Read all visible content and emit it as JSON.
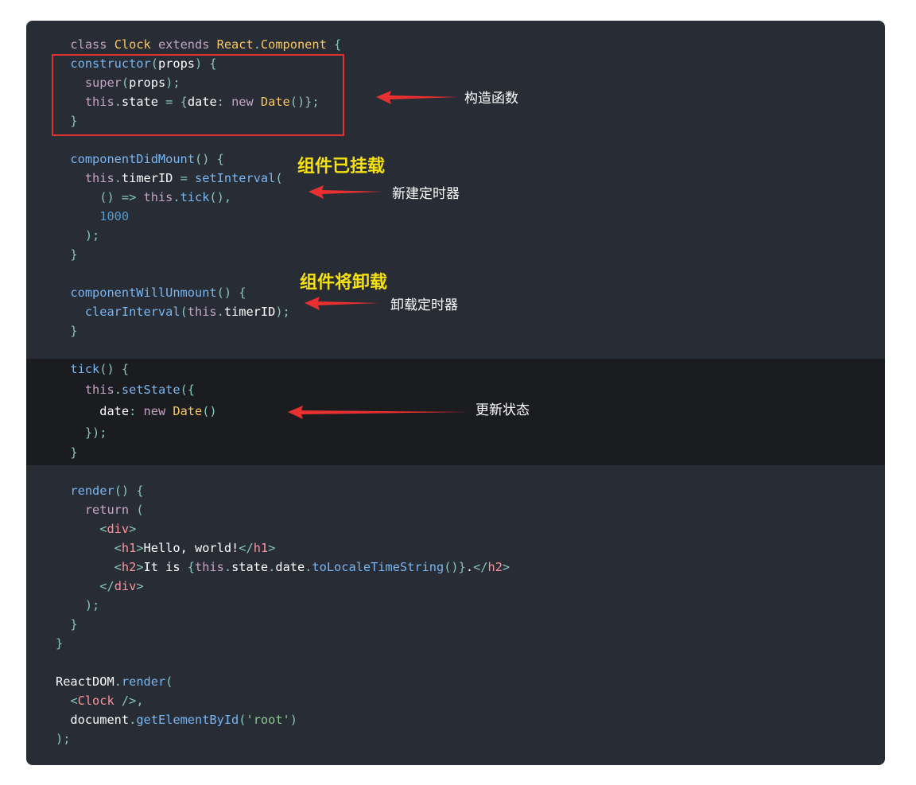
{
  "colors": {
    "background": "#282c34",
    "highlight_band": "#1b1c20",
    "annotation_red": "#e03030",
    "annotation_yellow": "#f5e10f"
  },
  "code_lines": [
    [
      [
        "  class ",
        "kw"
      ],
      [
        "Clock",
        "cls"
      ],
      [
        " extends ",
        "kw"
      ],
      [
        "React",
        "cls"
      ],
      [
        ".",
        "punc"
      ],
      [
        "Component",
        "cls"
      ],
      [
        " {",
        "punc"
      ]
    ],
    [
      [
        "  constructor",
        "fn"
      ],
      [
        "(",
        "punc"
      ],
      [
        "props",
        "var"
      ],
      [
        ") {",
        "punc"
      ]
    ],
    [
      [
        "    super",
        "kw"
      ],
      [
        "(",
        "punc"
      ],
      [
        "props",
        "var"
      ],
      [
        ");",
        "punc"
      ]
    ],
    [
      [
        "    this",
        "kw"
      ],
      [
        ".",
        "punc"
      ],
      [
        "state",
        "var"
      ],
      [
        " = {",
        "punc"
      ],
      [
        "date",
        "var"
      ],
      [
        ": ",
        "punc"
      ],
      [
        "new ",
        "kw"
      ],
      [
        "Date",
        "cls"
      ],
      [
        "()};",
        "punc"
      ]
    ],
    [
      [
        "  }",
        "punc"
      ]
    ],
    [],
    [
      [
        "  componentDidMount",
        "fn"
      ],
      [
        "() {",
        "punc"
      ]
    ],
    [
      [
        "    this",
        "kw"
      ],
      [
        ".",
        "punc"
      ],
      [
        "timerID",
        "var"
      ],
      [
        " = ",
        "punc"
      ],
      [
        "setInterval",
        "fn"
      ],
      [
        "(",
        "punc"
      ]
    ],
    [
      [
        "      () => ",
        "punc"
      ],
      [
        "this",
        "kw"
      ],
      [
        ".",
        "punc"
      ],
      [
        "tick",
        "fn"
      ],
      [
        "(),",
        "punc"
      ]
    ],
    [
      [
        "      1000",
        "num"
      ]
    ],
    [
      [
        "    );",
        "punc"
      ]
    ],
    [
      [
        "  }",
        "punc"
      ]
    ],
    [],
    [
      [
        "  componentWillUnmount",
        "fn"
      ],
      [
        "() {",
        "punc"
      ]
    ],
    [
      [
        "    clearInterval",
        "fn"
      ],
      [
        "(",
        "punc"
      ],
      [
        "this",
        "kw"
      ],
      [
        ".",
        "punc"
      ],
      [
        "timerID",
        "var"
      ],
      [
        ");",
        "punc"
      ]
    ],
    [
      [
        "  }",
        "punc"
      ]
    ],
    [],
    [
      [
        "  tick",
        "fn"
      ],
      [
        "() {",
        "punc"
      ]
    ],
    [
      [
        "    this",
        "kw"
      ],
      [
        ".",
        "punc"
      ],
      [
        "setState",
        "fn"
      ],
      [
        "({",
        "punc"
      ]
    ],
    [
      [
        "      date",
        "var"
      ],
      [
        ": ",
        "punc"
      ],
      [
        "new ",
        "kw"
      ],
      [
        "Date",
        "cls"
      ],
      [
        "()",
        "punc"
      ]
    ],
    [
      [
        "    });",
        "punc"
      ]
    ],
    [
      [
        "  }",
        "punc"
      ]
    ],
    [],
    [
      [
        "  render",
        "fn"
      ],
      [
        "() {",
        "punc"
      ]
    ],
    [
      [
        "    return ",
        "kw"
      ],
      [
        "(",
        "punc"
      ]
    ],
    [
      [
        "      <",
        "punc"
      ],
      [
        "div",
        "tag"
      ],
      [
        ">",
        "punc"
      ]
    ],
    [
      [
        "        <",
        "punc"
      ],
      [
        "h1",
        "tag"
      ],
      [
        ">",
        "punc"
      ],
      [
        "Hello, world!",
        "var"
      ],
      [
        "</",
        "punc"
      ],
      [
        "h1",
        "tag"
      ],
      [
        ">",
        "punc"
      ]
    ],
    [
      [
        "        <",
        "punc"
      ],
      [
        "h2",
        "tag"
      ],
      [
        ">",
        "punc"
      ],
      [
        "It is ",
        "var"
      ],
      [
        "{",
        "punc"
      ],
      [
        "this",
        "kw"
      ],
      [
        ".",
        "punc"
      ],
      [
        "state",
        "var"
      ],
      [
        ".",
        "punc"
      ],
      [
        "date",
        "var"
      ],
      [
        ".",
        "punc"
      ],
      [
        "toLocaleTimeString",
        "fn"
      ],
      [
        "()}",
        "punc"
      ],
      [
        ".",
        "var"
      ],
      [
        "</",
        "punc"
      ],
      [
        "h2",
        "tag"
      ],
      [
        ">",
        "punc"
      ]
    ],
    [
      [
        "      </",
        "punc"
      ],
      [
        "div",
        "tag"
      ],
      [
        ">",
        "punc"
      ]
    ],
    [
      [
        "    );",
        "punc"
      ]
    ],
    [
      [
        "  }",
        "punc"
      ]
    ],
    [
      [
        "}",
        "punc"
      ]
    ],
    [],
    [
      [
        "ReactDOM",
        "var"
      ],
      [
        ".",
        "punc"
      ],
      [
        "render",
        "fn"
      ],
      [
        "(",
        "punc"
      ]
    ],
    [
      [
        "  <",
        "punc"
      ],
      [
        "Clock",
        "tag"
      ],
      [
        " />,",
        "punc"
      ]
    ],
    [
      [
        "  document",
        "var"
      ],
      [
        ".",
        "punc"
      ],
      [
        "getElementById",
        "fn"
      ],
      [
        "(",
        "punc"
      ],
      [
        "'root'",
        "str"
      ],
      [
        ")",
        "punc"
      ]
    ],
    [
      [
        ");",
        "punc"
      ]
    ]
  ],
  "annotations": {
    "constructor_label": "构造函数",
    "mount_title": "组件已挂载",
    "mount_label": "新建定时器",
    "unmount_title": "组件将卸载",
    "unmount_label": "卸载定时器",
    "tick_label": "更新状态"
  }
}
